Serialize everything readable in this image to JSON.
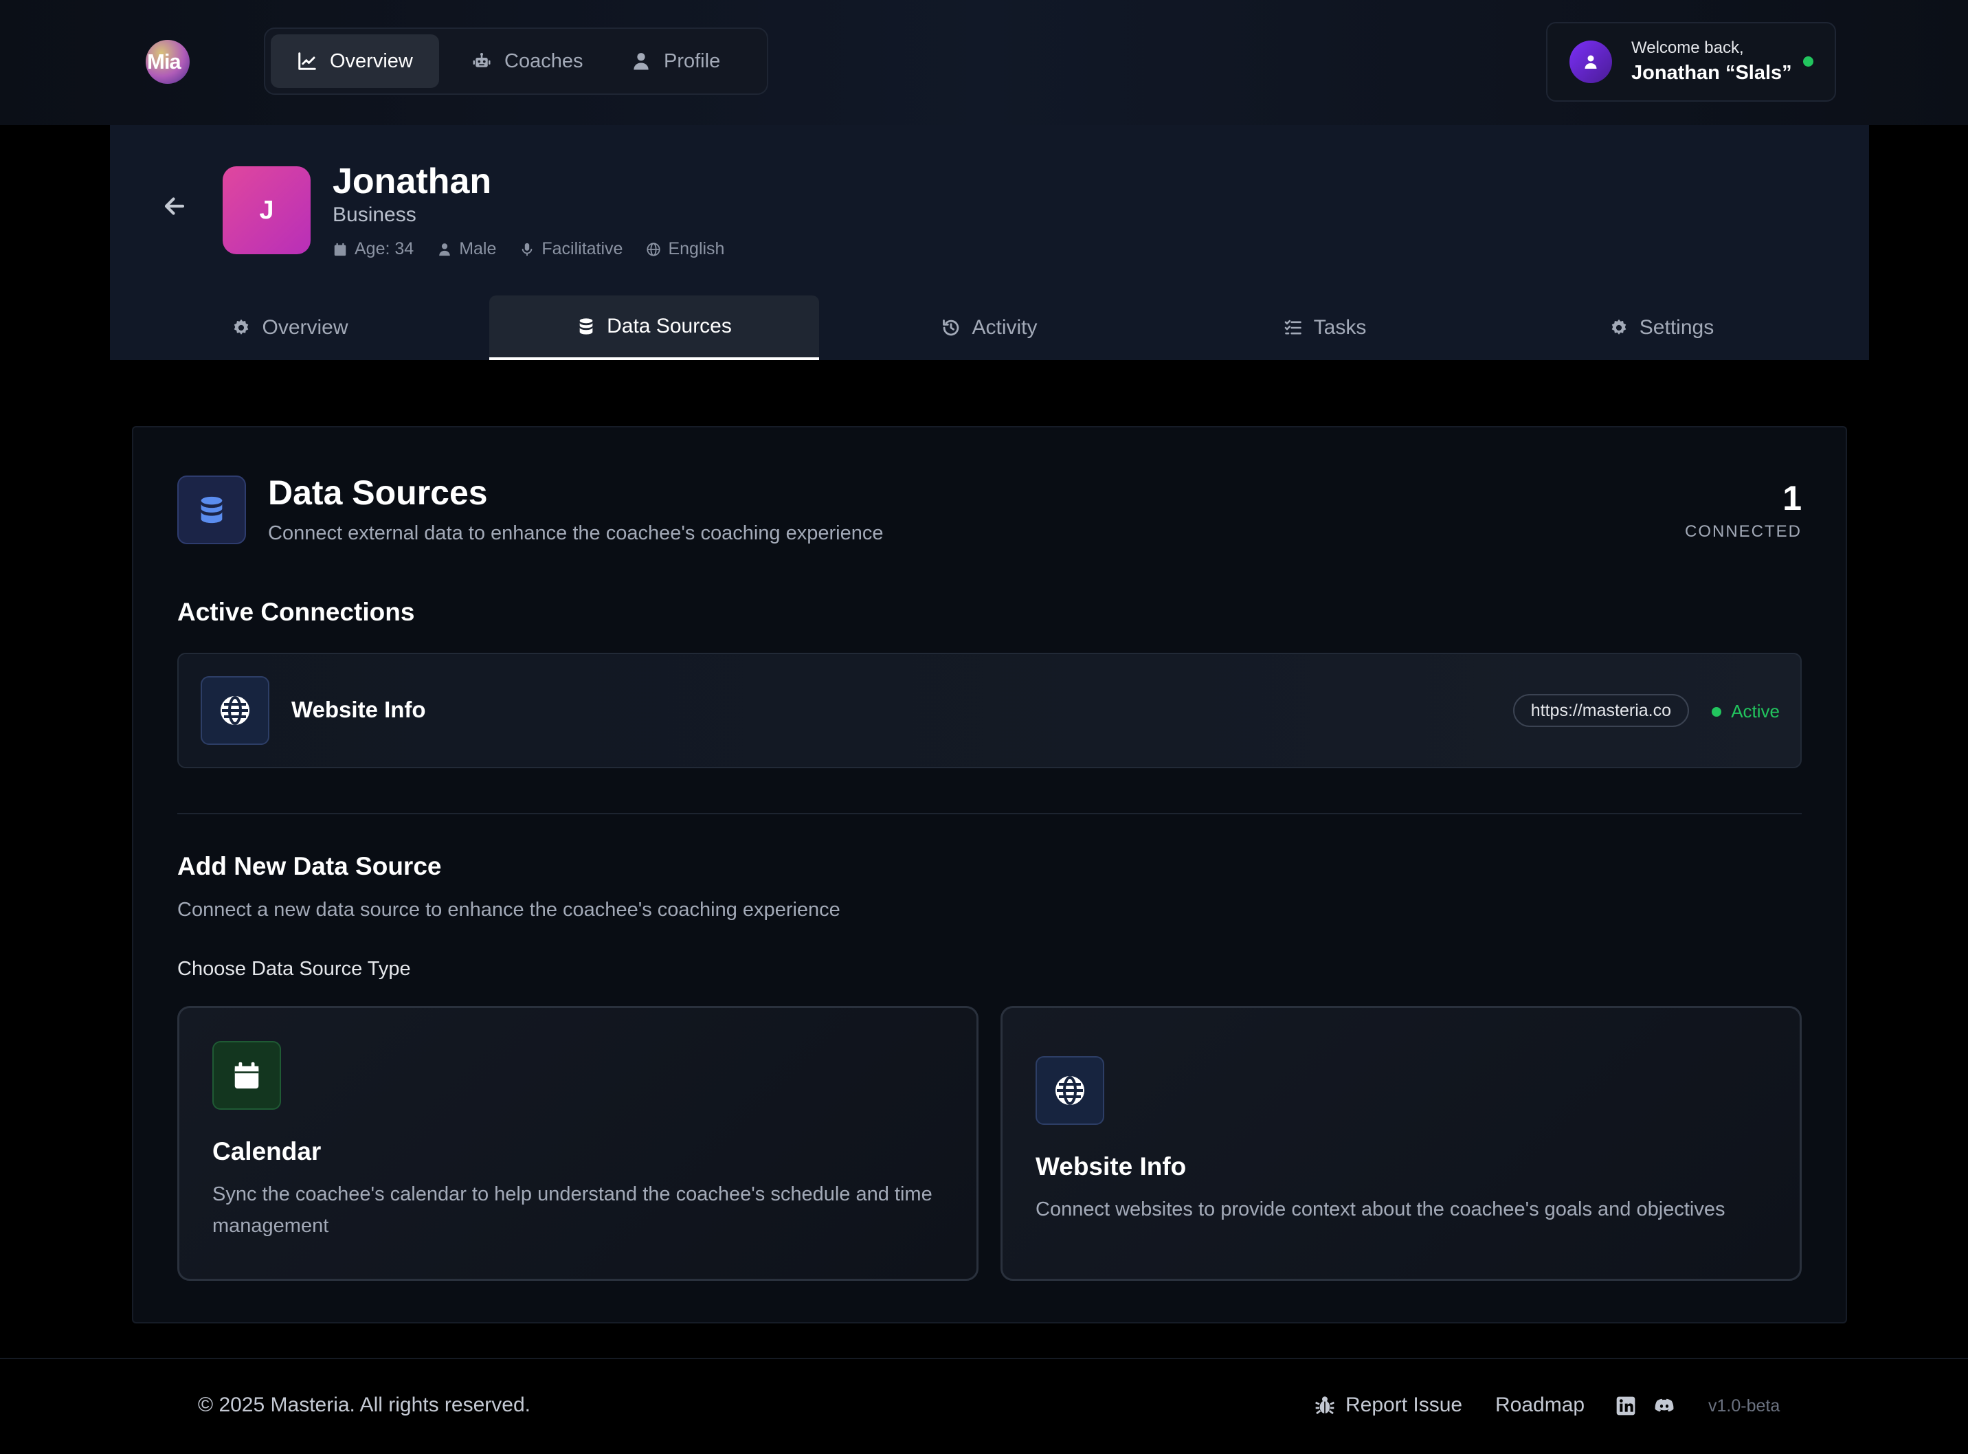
{
  "app": {
    "logo_text": "Mia"
  },
  "topnav": {
    "items": [
      {
        "label": "Overview",
        "icon": "chart-line-icon",
        "active": true
      },
      {
        "label": "Coaches",
        "icon": "robot-icon",
        "active": false
      },
      {
        "label": "Profile",
        "icon": "user-icon",
        "active": false
      }
    ]
  },
  "user": {
    "welcome": "Welcome back,",
    "name": "Jonathan “Slals”",
    "status_color": "#22c55e"
  },
  "profile": {
    "initial": "J",
    "name": "Jonathan",
    "role": "Business",
    "meta": {
      "age": "Age: 34",
      "gender": "Male",
      "style": "Facilitative",
      "language": "English"
    }
  },
  "tabs": [
    {
      "label": "Overview",
      "icon": "gear-icon",
      "active": false
    },
    {
      "label": "Data Sources",
      "icon": "database-icon",
      "active": true
    },
    {
      "label": "Activity",
      "icon": "history-icon",
      "active": false
    },
    {
      "label": "Tasks",
      "icon": "list-check-icon",
      "active": false
    },
    {
      "label": "Settings",
      "icon": "gear-icon",
      "active": false
    }
  ],
  "data_sources": {
    "title": "Data Sources",
    "subtitle": "Connect external data to enhance the coachee's coaching experience",
    "connected_count": "1",
    "connected_label": "CONNECTED",
    "active_connections_title": "Active Connections",
    "connections": [
      {
        "name": "Website Info",
        "url": "https://masteria.co",
        "status": "Active",
        "icon": "globe-icon"
      }
    ],
    "add_title": "Add New Data Source",
    "add_subtitle": "Connect a new data source to enhance the coachee's coaching experience",
    "choose_label": "Choose Data Source Type",
    "types": [
      {
        "title": "Calendar",
        "description": "Sync the coachee's calendar to help understand the coachee's schedule and time management",
        "icon": "calendar-icon",
        "accent": "#13361f"
      },
      {
        "title": "Website Info",
        "description": "Connect websites to provide context about the coachee's goals and objectives",
        "icon": "globe-icon",
        "accent": "#17243f"
      }
    ]
  },
  "footer": {
    "copyright": "© 2025 Masteria. All rights reserved.",
    "report_issue": "Report Issue",
    "roadmap": "Roadmap",
    "version": "v1.0-beta"
  }
}
